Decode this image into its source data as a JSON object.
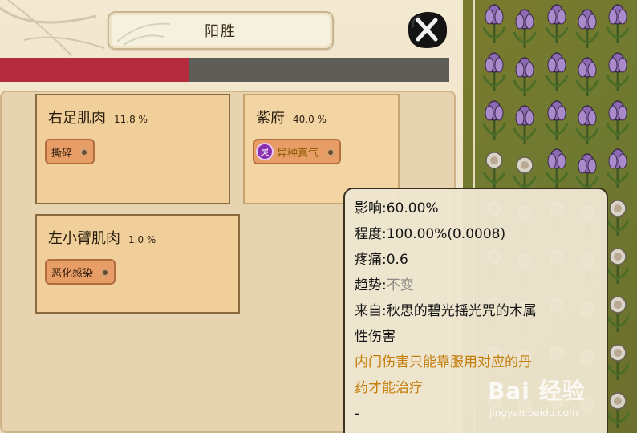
{
  "window": {
    "title": "阳胜",
    "close_icon": "close-x-icon"
  },
  "health_bar": {
    "fill_fraction": 0.42,
    "fill_color": "#b32b3c",
    "track_color": "#5f5d58"
  },
  "injuries": [
    {
      "part": "右足肌肉",
      "percent": "11.8 %",
      "tag": "撕碎",
      "tag_icon": null
    },
    {
      "part": "紫府",
      "percent": "40.0 %",
      "tag": "异种真气",
      "tag_icon": "灵"
    },
    {
      "part": "左小臂肌肉",
      "percent": "1.0 %",
      "tag": "恶化感染",
      "tag_icon": null
    }
  ],
  "tooltip": {
    "influence": "影响:60.00%",
    "degree": "程度:100.00%(0.0008)",
    "pain": "疼痛:0.6",
    "trend_label": "趋势:",
    "trend_value": "不变",
    "source_line1": "来自:秋思的碧光摇光咒的木属",
    "source_line2": "性伤害",
    "warning_line1": "内门伤害只能靠服用对应的丹",
    "warning_line2": "药才能治疗",
    "footer": "-"
  },
  "watermark": {
    "brand": "Bai 经验",
    "url": "jingyan.baidu.com"
  }
}
